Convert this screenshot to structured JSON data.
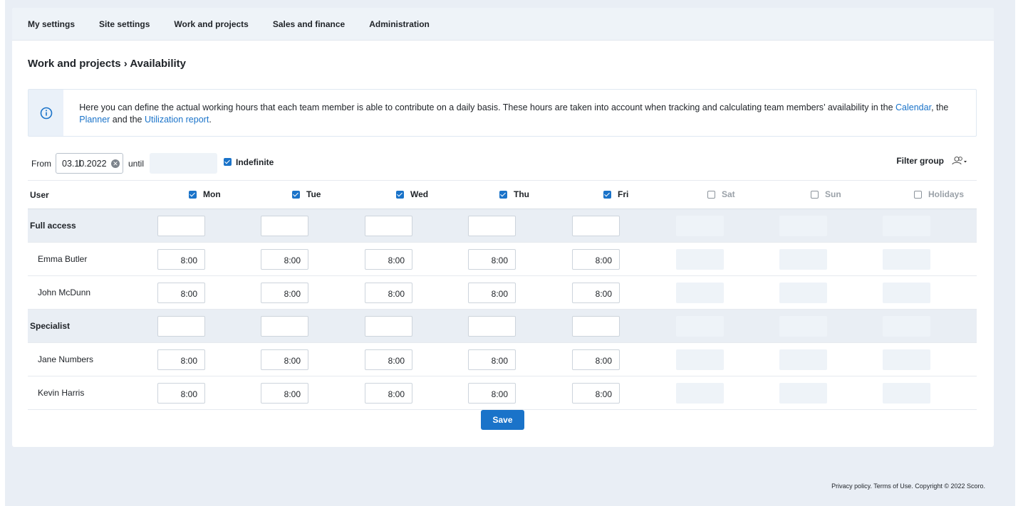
{
  "nav": [
    "My settings",
    "Site settings",
    "Work and projects",
    "Sales and finance",
    "Administration"
  ],
  "page_title": "Work and projects › Availability",
  "info": {
    "text_before": "Here you can define the actual working hours that each team member is able to contribute on a daily basis. These hours are taken into account when tracking and calculating team members’ availability in the ",
    "link_calendar": "Calendar",
    "sep1": ", the ",
    "link_planner": "Planner",
    "sep2": " and the ",
    "link_report": "Utilization report",
    "end": "."
  },
  "filter": {
    "from_label": "From",
    "from_value": "03.10.2022",
    "until_label": "until",
    "indefinite_label": "Indefinite",
    "filter_group_label": "Filter group"
  },
  "table": {
    "user_header": "User",
    "days": [
      {
        "label": "Mon",
        "checked": true
      },
      {
        "label": "Tue",
        "checked": true
      },
      {
        "label": "Wed",
        "checked": true
      },
      {
        "label": "Thu",
        "checked": true
      },
      {
        "label": "Fri",
        "checked": true
      },
      {
        "label": "Sat",
        "checked": false
      },
      {
        "label": "Sun",
        "checked": false
      },
      {
        "label": "Holidays",
        "checked": false
      }
    ],
    "rows": [
      {
        "type": "group",
        "name": "Full access",
        "hours": [
          "",
          "",
          "",
          "",
          ""
        ]
      },
      {
        "type": "user",
        "name": "Emma Butler",
        "hours": [
          "8:00",
          "8:00",
          "8:00",
          "8:00",
          "8:00"
        ]
      },
      {
        "type": "user",
        "name": "John McDunn",
        "hours": [
          "8:00",
          "8:00",
          "8:00",
          "8:00",
          "8:00"
        ]
      },
      {
        "type": "group",
        "name": "Specialist",
        "hours": [
          "",
          "",
          "",
          "",
          ""
        ]
      },
      {
        "type": "user",
        "name": "Jane Numbers",
        "hours": [
          "8:00",
          "8:00",
          "8:00",
          "8:00",
          "8:00"
        ]
      },
      {
        "type": "user",
        "name": "Kevin Harris",
        "hours": [
          "8:00",
          "8:00",
          "8:00",
          "8:00",
          "8:00"
        ]
      }
    ]
  },
  "save_label": "Save",
  "footer": "Privacy policy. Terms of Use. Copyright © 2022 Scoro.",
  "colors": {
    "accent": "#1a73c9",
    "group_bg": "#e9eef4",
    "page_bg": "#e9eef5"
  }
}
